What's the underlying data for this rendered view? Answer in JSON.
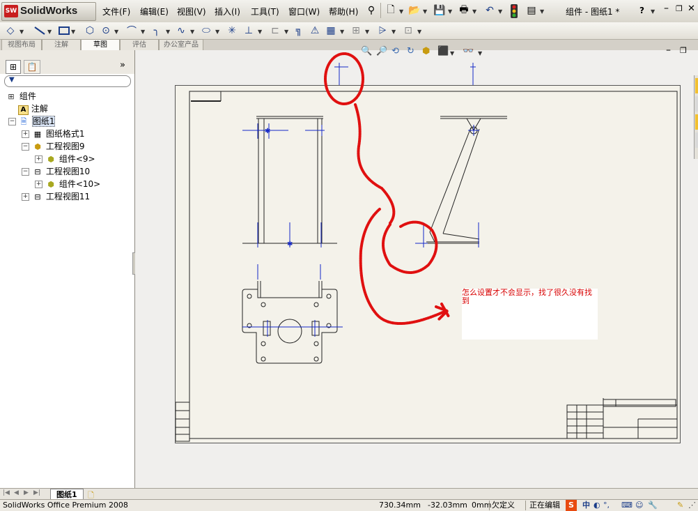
{
  "app": {
    "logo_badge": "SW",
    "logo_name": "SolidWorks",
    "document_title": "组件 - 图纸1 *"
  },
  "menu": [
    "文件(F)",
    "编辑(E)",
    "视图(V)",
    "插入(I)",
    "工具(T)",
    "窗口(W)",
    "帮助(H)"
  ],
  "title_controls": {
    "help": "?"
  },
  "command_tabs": [
    "视图布局",
    "注解",
    "草图",
    "评估",
    "办公室产品"
  ],
  "active_tab": "草图",
  "tree": {
    "root": "组件",
    "items": [
      {
        "label": "注解",
        "level": 1
      },
      {
        "label": "图纸1",
        "level": 1
      },
      {
        "label": "图纸格式1",
        "level": 2
      },
      {
        "label": "工程视图9",
        "level": 2
      },
      {
        "label": "组件<9>",
        "level": 3
      },
      {
        "label": "工程视图10",
        "level": 2
      },
      {
        "label": "组件<10>",
        "level": 3
      },
      {
        "label": "工程视图11",
        "level": 2
      }
    ]
  },
  "annotation": {
    "text": "怎么设置才不会显示，找了很久没有找到",
    "color": "#d80000"
  },
  "sheet_tabs": [
    "图纸1"
  ],
  "status": {
    "product": "SolidWorks Office Premium 2008",
    "x": "730.34mm",
    "y": "-32.03mm",
    "z": "0mm",
    "state": "欠定义",
    "mode": "正在编辑",
    "ime_label": "中"
  },
  "colors": {
    "accent_blue": "#1a3c88",
    "dimension_blue": "#1428c8",
    "annotation_red": "#e01010",
    "logo_red": "#c81e1e"
  }
}
